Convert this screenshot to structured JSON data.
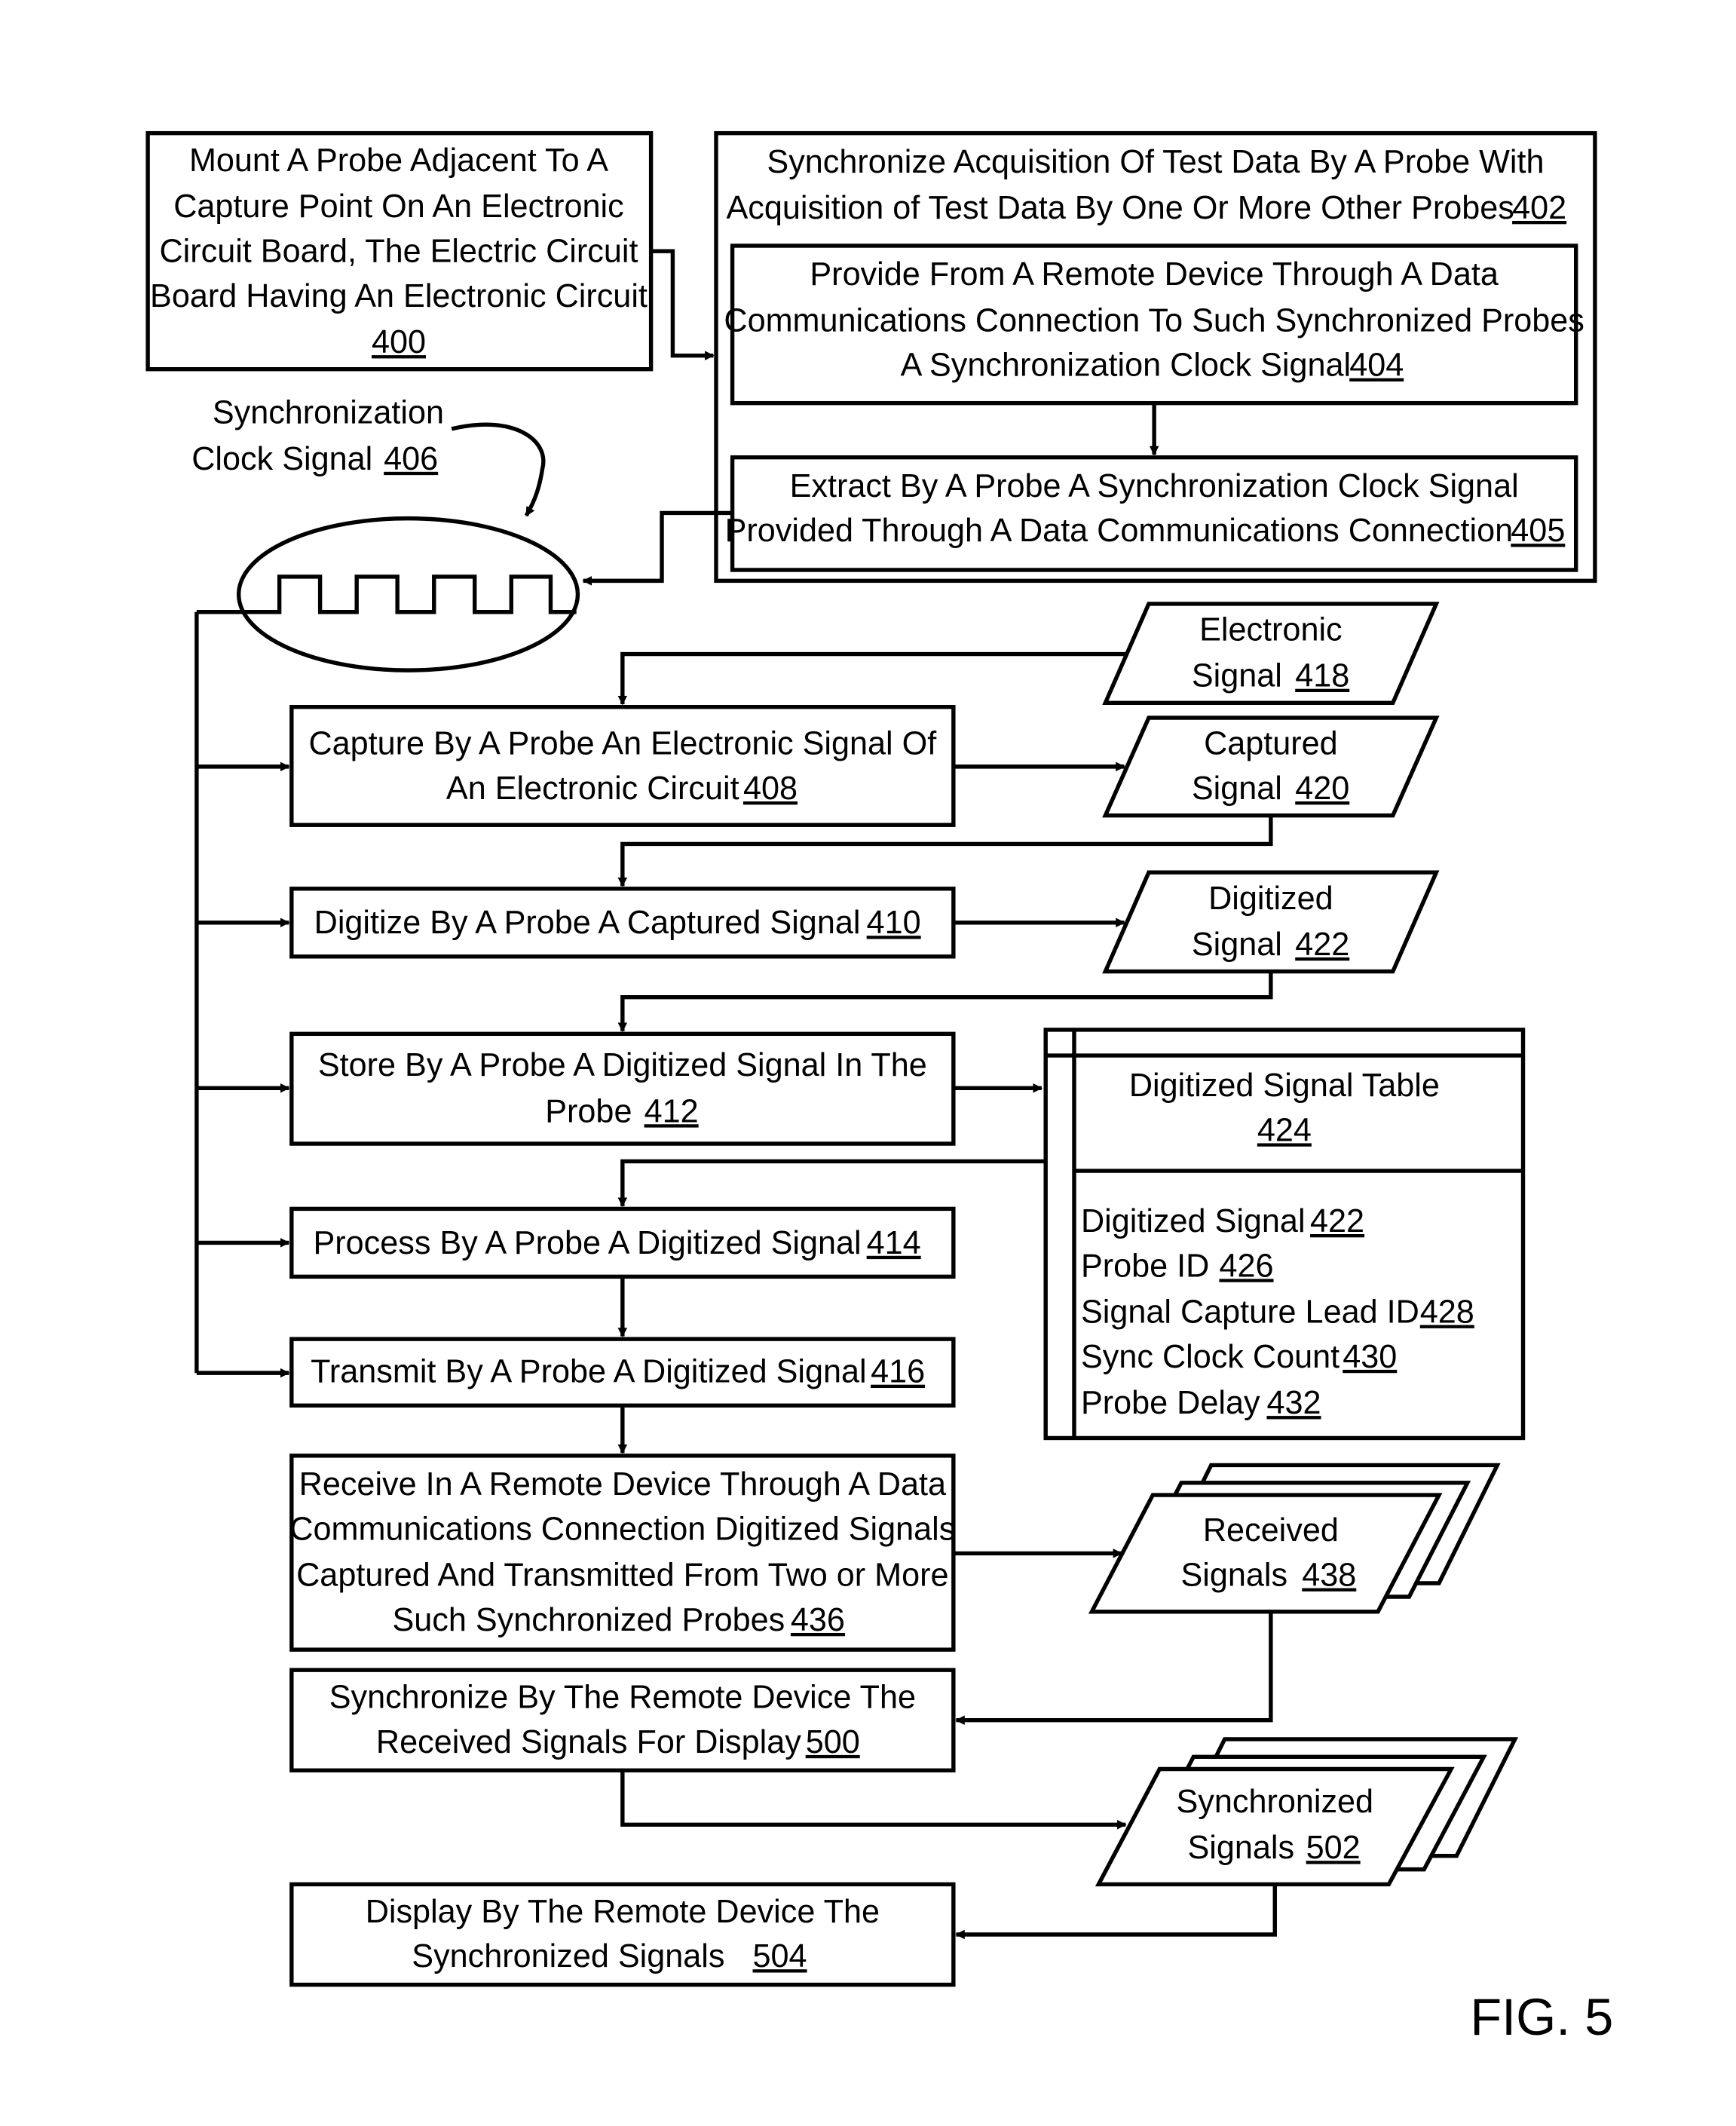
{
  "figure_label": "FIG. 5",
  "steps": {
    "s400": {
      "lines": [
        "Mount A Probe Adjacent To A",
        "Capture Point On An Electronic",
        "Circuit Board, The Electric Circuit",
        "Board Having An Electronic Circuit"
      ],
      "ref": "400"
    },
    "s402": {
      "lines": [
        "Synchronize Acquisition Of Test Data By A Probe With",
        "Acquisition of Test Data By One Or More Other Probes"
      ],
      "ref": "402"
    },
    "s404": {
      "lines": [
        "Provide From A Remote Device Through A Data",
        "Communications Connection To Such Synchronized Probes",
        "A Synchronization Clock Signal"
      ],
      "ref": "404"
    },
    "s405": {
      "lines": [
        "Extract By A Probe A Synchronization Clock Signal",
        "Provided Through A Data Communications Connection"
      ],
      "ref": "405"
    },
    "s408": {
      "lines": [
        "Capture By A Probe An Electronic Signal Of",
        "An Electronic Circuit"
      ],
      "ref": "408"
    },
    "s410": {
      "lines": [
        "Digitize By A Probe A Captured Signal"
      ],
      "ref": "410"
    },
    "s412": {
      "lines": [
        "Store By A Probe A Digitized Signal In The",
        "Probe"
      ],
      "ref": "412"
    },
    "s414": {
      "lines": [
        "Process By A Probe A Digitized Signal"
      ],
      "ref": "414"
    },
    "s416": {
      "lines": [
        "Transmit By A Probe A Digitized Signal"
      ],
      "ref": "416"
    },
    "s436": {
      "lines": [
        "Receive In A Remote Device Through A Data",
        "Communications Connection Digitized Signals",
        "Captured And Transmitted From Two or More",
        "Such Synchronized Probes"
      ],
      "ref": "436"
    },
    "s500": {
      "lines": [
        "Synchronize By The Remote Device The",
        "Received Signals For Display"
      ],
      "ref": "500"
    },
    "s504": {
      "lines": [
        "Display By The Remote Device The",
        "Synchronized Signals"
      ],
      "ref": "504"
    }
  },
  "clock_signal": {
    "lines": [
      "Synchronization",
      "Clock Signal"
    ],
    "ref": "406"
  },
  "data_items": {
    "d418": {
      "lines": [
        "Electronic",
        "Signal"
      ],
      "ref": "418"
    },
    "d420": {
      "lines": [
        "Captured",
        "Signal"
      ],
      "ref": "420"
    },
    "d422": {
      "lines": [
        "Digitized",
        "Signal"
      ],
      "ref": "422"
    },
    "d438": {
      "lines": [
        "Received",
        "Signals"
      ],
      "ref": "438"
    },
    "d502": {
      "lines": [
        "Synchronized",
        "Signals"
      ],
      "ref": "502"
    }
  },
  "table": {
    "title": "Digitized Signal Table",
    "ref": "424",
    "fields": [
      {
        "label": "Digitized Signal",
        "ref": "422"
      },
      {
        "label": "Probe ID",
        "ref": "426"
      },
      {
        "label": "Signal Capture Lead ID",
        "ref": "428"
      },
      {
        "label": "Sync Clock Count",
        "ref": "430"
      },
      {
        "label": "Probe Delay",
        "ref": "432"
      }
    ]
  }
}
